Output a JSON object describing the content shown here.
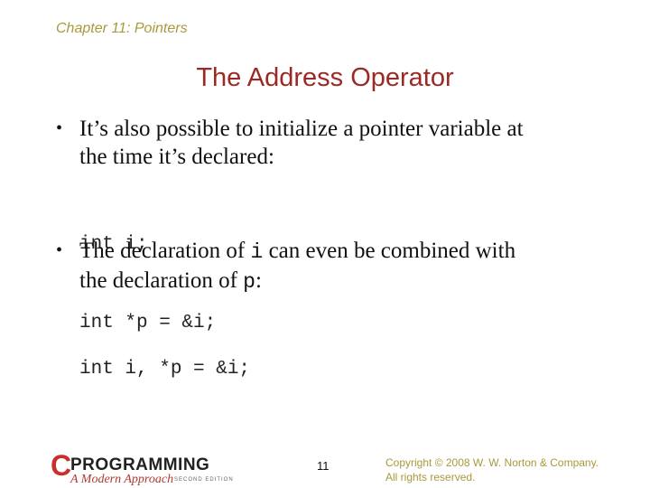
{
  "header": {
    "chapter": "Chapter 11: Pointers"
  },
  "slide": {
    "title": "The Address Operator",
    "bullets": [
      {
        "marker": "•",
        "line1": "It’s also possible to initialize a pointer variable at",
        "line2": "the time it’s declared:",
        "code": [
          "int i;",
          "int *p = &i;"
        ]
      },
      {
        "marker": "•",
        "pre": "The declaration of ",
        "code_inline_1": "i",
        "mid": " can even be combined with",
        "line2_pre": "the declaration of ",
        "code_inline_2": "p",
        "line2_post": ":",
        "code": [
          "int i, *p = &i;"
        ]
      }
    ]
  },
  "footer": {
    "logo": {
      "letter": "C",
      "word": "PROGRAMMING",
      "subtitle": "A Modern Approach",
      "edition": "SECOND EDITION"
    },
    "page_number": "11",
    "copyright_line1": "Copyright © 2008 W. W. Norton & Company.",
    "copyright_line2": "All rights reserved."
  },
  "colors": {
    "header": "#a89a3c",
    "title": "#9b2a24",
    "logo_red": "#c8312b"
  }
}
